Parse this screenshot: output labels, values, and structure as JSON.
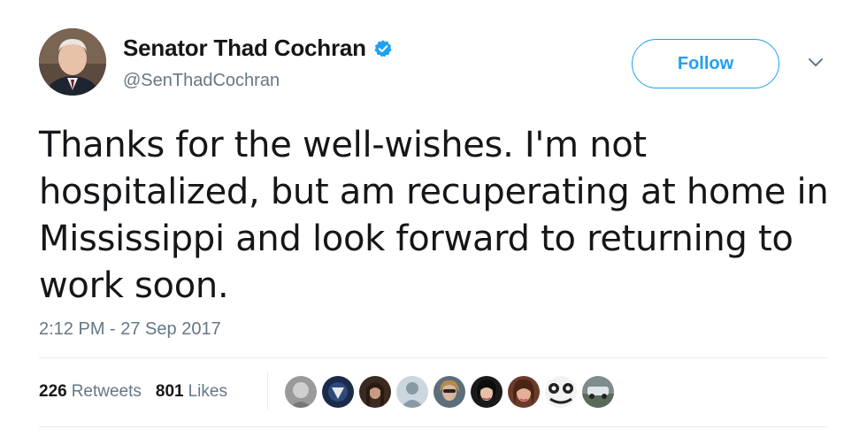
{
  "tweet": {
    "author_name": "Senator Thad Cochran",
    "handle": "@SenThadCochran",
    "text": "Thanks for the well-wishes. I'm not hospitalized, but am recuperating at home in Mississippi and look forward to returning to work soon.",
    "timestamp": "2:12 PM - 27 Sep 2017"
  },
  "actions": {
    "follow_label": "Follow"
  },
  "stats": {
    "retweets_count": "226",
    "retweets_label": "Retweets",
    "likes_count": "801",
    "likes_label": "Likes"
  },
  "colors": {
    "accent": "#1da1f2",
    "secondary_text": "#657786",
    "primary_text": "#14171a",
    "divider": "#e6ecf0"
  },
  "icons": {
    "verified": "verified-badge-icon",
    "caret": "chevron-down-icon"
  },
  "likers": [
    {
      "avatar": "liker-avatar-1"
    },
    {
      "avatar": "liker-avatar-2"
    },
    {
      "avatar": "liker-avatar-3"
    },
    {
      "avatar": "liker-avatar-4"
    },
    {
      "avatar": "liker-avatar-5"
    },
    {
      "avatar": "liker-avatar-6"
    },
    {
      "avatar": "liker-avatar-7"
    },
    {
      "avatar": "liker-avatar-8"
    },
    {
      "avatar": "liker-avatar-9"
    }
  ]
}
